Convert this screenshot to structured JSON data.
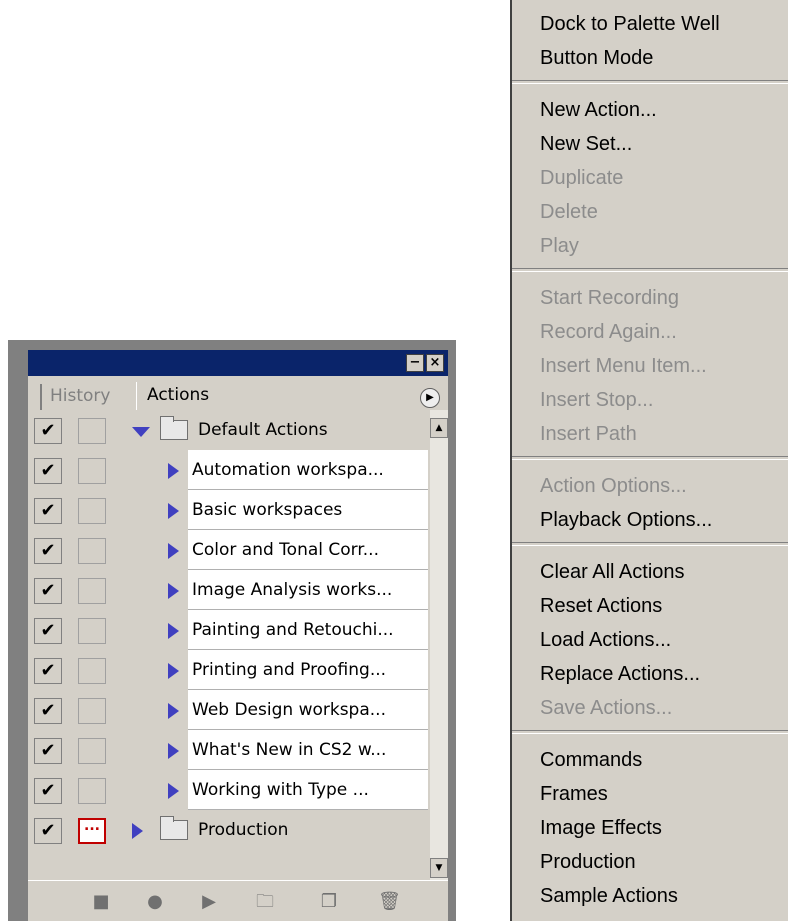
{
  "palette": {
    "minimize_glyph": "−",
    "close_glyph": "×",
    "tabs": [
      {
        "label": "History",
        "active": false
      },
      {
        "label": "Actions",
        "active": true
      }
    ],
    "menu_arrow_glyph": "▶",
    "set_default": {
      "label": "Default Actions",
      "expanded": true
    },
    "actions": [
      "Automation workspa...",
      "Basic workspaces",
      "Color and Tonal Corr...",
      "Image Analysis works...",
      "Painting and Retouchi...",
      "Printing and Proofing...",
      "Web Design workspa...",
      "What's New in CS2 w...",
      "Working with Type ..."
    ],
    "set_production": {
      "label": "Production",
      "expanded": false
    },
    "check_glyph": "✔",
    "bottom_icons": [
      "stop-icon",
      "record-icon",
      "play-icon",
      "new-set-icon",
      "new-action-icon",
      "trash-icon"
    ]
  },
  "menu": {
    "groups": [
      [
        {
          "label": "Dock to Palette Well",
          "enabled": true
        },
        {
          "label": "Button Mode",
          "enabled": true
        }
      ],
      [
        {
          "label": "New Action...",
          "enabled": true
        },
        {
          "label": "New Set...",
          "enabled": true
        },
        {
          "label": "Duplicate",
          "enabled": false
        },
        {
          "label": "Delete",
          "enabled": false
        },
        {
          "label": "Play",
          "enabled": false
        }
      ],
      [
        {
          "label": "Start Recording",
          "enabled": false
        },
        {
          "label": "Record Again...",
          "enabled": false
        },
        {
          "label": "Insert Menu Item...",
          "enabled": false
        },
        {
          "label": "Insert Stop...",
          "enabled": false
        },
        {
          "label": "Insert Path",
          "enabled": false
        }
      ],
      [
        {
          "label": "Action Options...",
          "enabled": false
        },
        {
          "label": "Playback Options...",
          "enabled": true
        }
      ],
      [
        {
          "label": "Clear All Actions",
          "enabled": true
        },
        {
          "label": "Reset Actions",
          "enabled": true
        },
        {
          "label": "Load Actions...",
          "enabled": true
        },
        {
          "label": "Replace Actions...",
          "enabled": true
        },
        {
          "label": "Save Actions...",
          "enabled": false
        }
      ],
      [
        {
          "label": "Commands",
          "enabled": true
        },
        {
          "label": "Frames",
          "enabled": true
        },
        {
          "label": "Image Effects",
          "enabled": true
        },
        {
          "label": "Production",
          "enabled": true
        },
        {
          "label": "Sample Actions",
          "enabled": true
        }
      ]
    ]
  }
}
